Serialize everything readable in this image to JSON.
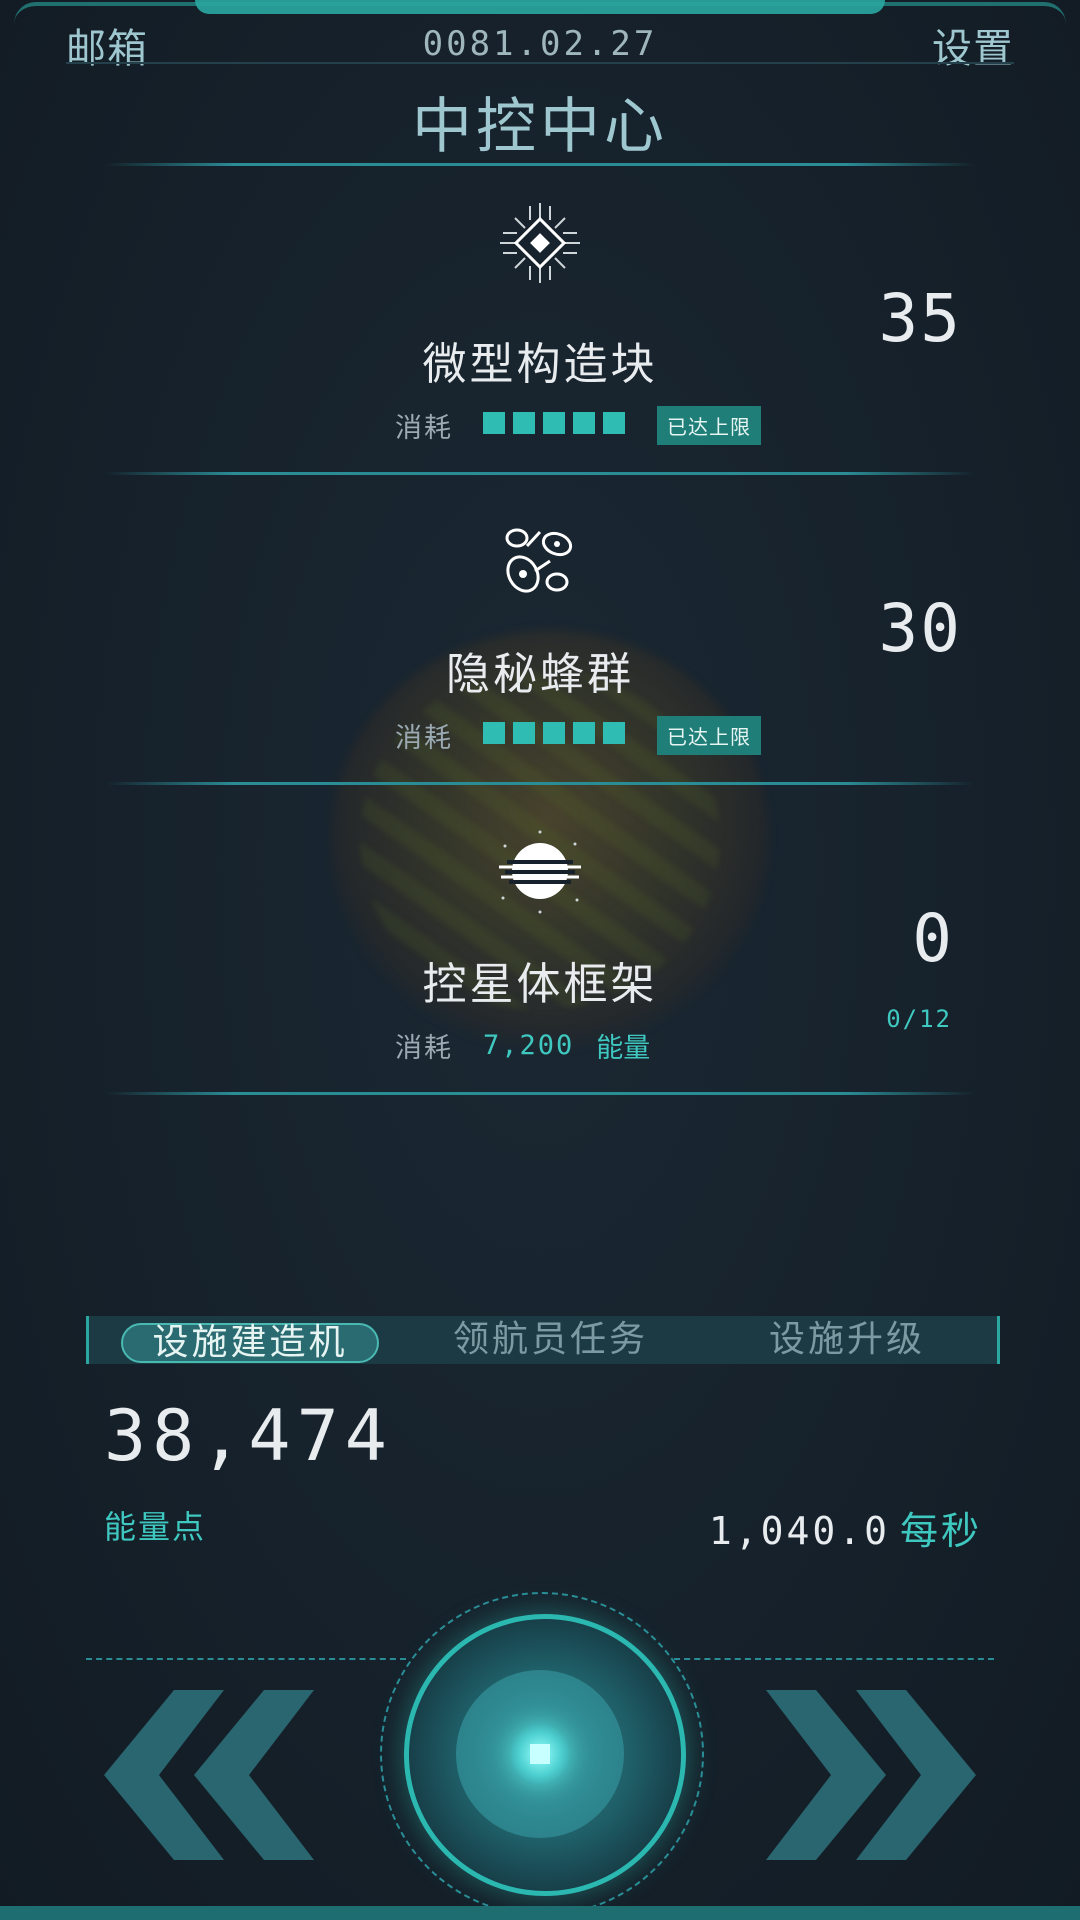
{
  "header": {
    "mail": "邮箱",
    "date": "0081.02.27",
    "settings": "设置",
    "title": "中控中心"
  },
  "items": [
    {
      "icon": "chip-icon",
      "name": "微型构造块",
      "cost_label": "消耗",
      "pips": 5,
      "badge": "已达上限",
      "count": "35"
    },
    {
      "icon": "swarm-icon",
      "name": "隐秘蜂群",
      "cost_label": "消耗",
      "pips": 5,
      "badge": "已达上限",
      "count": "30"
    },
    {
      "icon": "planet-icon",
      "name": "控星体框架",
      "cost_label": "消耗",
      "cost_value": "7,200",
      "cost_unit": "能量",
      "count": "0",
      "sub": "0/12"
    }
  ],
  "tabs": [
    "设施建造机",
    "领航员任务",
    "设施升级"
  ],
  "energy": {
    "value": "38,474",
    "label": "能量点",
    "rate": "1,040.0",
    "rate_unit": "每秒"
  },
  "colors": {
    "accent": "#2fbcb3",
    "background": "#16212b",
    "text_light": "#e8ecef"
  }
}
